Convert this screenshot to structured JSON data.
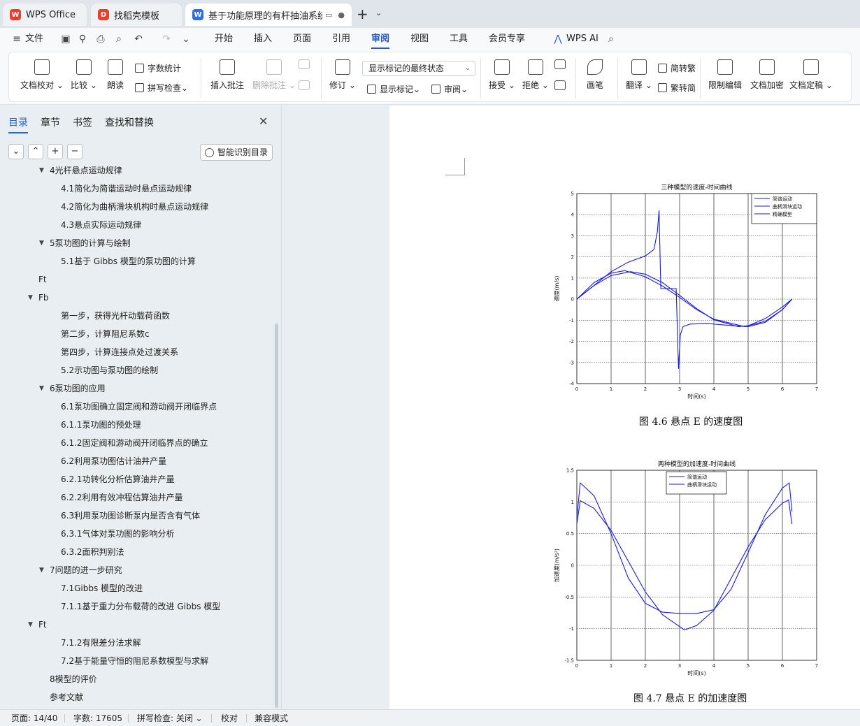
{
  "tabs": [
    {
      "label": "WPS Office",
      "icon": "wps-logo-icon",
      "color": "#e8402e"
    },
    {
      "label": "找稻壳模板",
      "icon": "docer-icon",
      "color": "#e8402e"
    },
    {
      "label": "基于功能原理的有杆抽油系统故",
      "icon": "writer-doc-icon",
      "color": "#2f6fe0"
    }
  ],
  "menu": {
    "file": "文件",
    "items": [
      "开始",
      "插入",
      "页面",
      "引用",
      "审阅",
      "视图",
      "工具",
      "会员专享"
    ],
    "active": "审阅",
    "ai": "WPS AI"
  },
  "ribbon": {
    "doc_check": "文档校对",
    "compare": "比较",
    "read_aloud": "朗读",
    "word_count": "字数统计",
    "spell_check": "拼写检查",
    "insert_comment": "插入批注",
    "delete_comment": "删除批注",
    "track_changes": "修订",
    "markup_state": "显示标记的最终状态",
    "show_markup": "显示标记",
    "review": "审阅",
    "accept": "接受",
    "reject": "拒绝",
    "pen": "画笔",
    "translate": "翻译",
    "s2t": "简转繁",
    "t2s": "繁转简",
    "restrict_edit": "限制编辑",
    "encrypt": "文档加密",
    "finalize": "文档定稿"
  },
  "sidebar": {
    "tabs": [
      "目录",
      "章节",
      "书签",
      "查找和替换"
    ],
    "active_tab": "目录",
    "smart_toc": "智能识别目录",
    "toc": [
      {
        "label": "4光杆悬点运动规律",
        "level": 1,
        "arrow": true
      },
      {
        "label": "4.1简化为简谐运动时悬点运动规律",
        "level": 2
      },
      {
        "label": "4.2简化为曲柄滑块机构时悬点运动规律",
        "level": 2
      },
      {
        "label": "4.3悬点实际运动规律",
        "level": 2
      },
      {
        "label": "5泵功图的计算与绘制",
        "level": 1,
        "arrow": true
      },
      {
        "label": "5.1基于 Gibbs 模型的泵功图的计算",
        "level": 2
      },
      {
        "label": "Ft",
        "level": 0
      },
      {
        "label": "Fb",
        "level": 0,
        "arrow": true
      },
      {
        "label": "第一步，获得光杆动载荷函数",
        "level": 2
      },
      {
        "label": "第二步，计算阻尼系数c",
        "level": 2
      },
      {
        "label": "第四步，计算连接点处过渡关系",
        "level": 2
      },
      {
        "label": "5.2示功图与泵功图的绘制",
        "level": 2
      },
      {
        "label": "6泵功图的应用",
        "level": 1,
        "arrow": true
      },
      {
        "label": "6.1泵功图确立固定阀和游动阀开闭临界点",
        "level": 2
      },
      {
        "label": "6.1.1泵功图的预处理",
        "level": 2
      },
      {
        "label": "6.1.2固定阀和游动阀开闭临界点的确立",
        "level": 2
      },
      {
        "label": "6.2利用泵功图估计油井产量",
        "level": 2
      },
      {
        "label": "6.2.1功转化分析估算油井产量",
        "level": 2
      },
      {
        "label": "6.2.2利用有效冲程估算油井产量",
        "level": 2
      },
      {
        "label": "6.3利用泵功图诊断泵内是否含有气体",
        "level": 2
      },
      {
        "label": "6.3.1气体对泵功图的影响分析",
        "level": 2
      },
      {
        "label": "6.3.2面积判别法",
        "level": 2
      },
      {
        "label": "7问题的进一步研究",
        "level": 1,
        "arrow": true
      },
      {
        "label": "7.1Gibbs 模型的改进",
        "level": 2
      },
      {
        "label": "7.1.1基于重力分布载荷的改进 Gibbs 模型",
        "level": 2
      },
      {
        "label": "Ft",
        "level": 0,
        "arrow": true
      },
      {
        "label": "7.1.2有限差分法求解",
        "level": 2
      },
      {
        "label": "7.2基于能量守恒的阻尼系数模型与求解",
        "level": 2
      },
      {
        "label": "8模型的评价",
        "level": 1
      },
      {
        "label": "参考文献",
        "level": 1
      }
    ]
  },
  "document": {
    "caption1": "图 4.6 悬点 E 的速度图",
    "caption2": "图 4.7 悬点 E 的加速度图"
  },
  "chart_data": [
    {
      "type": "line",
      "title": "三种模型的速度-时间曲线",
      "xlabel": "时间(s)",
      "ylabel": "速度(m/s)",
      "xlim": [
        0,
        7
      ],
      "ylim": [
        -4,
        5
      ],
      "xticks": [
        0,
        1,
        2,
        3,
        4,
        5,
        6,
        7
      ],
      "yticks": [
        -4,
        -3,
        -2,
        -1,
        0,
        1,
        2,
        3,
        4,
        5
      ],
      "grid": true,
      "legend": "top-right",
      "series": [
        {
          "name": "简谐运动",
          "x": [
            0,
            0.5,
            1,
            1.57,
            2,
            2.5,
            3,
            3.5,
            4,
            4.71,
            5,
            5.5,
            6,
            6.28
          ],
          "y": [
            0,
            0.64,
            1.12,
            1.3,
            1.18,
            0.78,
            0.18,
            -0.45,
            -0.98,
            -1.3,
            -1.26,
            -0.92,
            -0.37,
            0
          ]
        },
        {
          "name": "曲柄滑块运动",
          "x": [
            0,
            0.5,
            1,
            1.4,
            2,
            2.5,
            3,
            3.5,
            4,
            4.9,
            5.5,
            6,
            6.28
          ],
          "y": [
            0,
            0.78,
            1.23,
            1.35,
            1.06,
            0.62,
            0.08,
            -0.5,
            -0.95,
            -1.3,
            -1.05,
            -0.5,
            0
          ]
        },
        {
          "name": "精确模型",
          "x": [
            0,
            0.5,
            1,
            1.5,
            2,
            2.25,
            2.35,
            2.4,
            2.45,
            2.9,
            2.95,
            2.97,
            2.98,
            3.02,
            3.1,
            3.3,
            3.8,
            4.5,
            5,
            5.5,
            6,
            6.28
          ],
          "y": [
            0,
            0.65,
            1.3,
            1.75,
            2.05,
            2.35,
            3.2,
            4.2,
            0.5,
            0.5,
            -2.4,
            -3.3,
            -2.9,
            -1.7,
            -1.3,
            -1.18,
            -1.15,
            -1.25,
            -1.3,
            -1.1,
            -0.5,
            0
          ]
        }
      ]
    },
    {
      "type": "line",
      "title": "两种模型的加速度-时间曲线",
      "xlabel": "时间(s)",
      "ylabel": "加速度(m/s²)",
      "xlim": [
        0,
        7
      ],
      "ylim": [
        -1.5,
        1.5
      ],
      "xticks": [
        0,
        1,
        2,
        3,
        4,
        5,
        6,
        7
      ],
      "yticks": [
        -1.5,
        -1,
        -0.5,
        0,
        0.5,
        1,
        1.5
      ],
      "grid": true,
      "legend": "top-center",
      "series": [
        {
          "name": "简谐运动",
          "x": [
            0,
            0.1,
            0.5,
            1,
            1.57,
            2,
            2.5,
            3.14,
            3.5,
            4,
            4.71,
            5,
            5.5,
            6,
            6.18,
            6.28
          ],
          "y": [
            0.65,
            1.02,
            0.9,
            0.55,
            0.0,
            -0.42,
            -0.78,
            -1.02,
            -0.95,
            -0.71,
            0.0,
            0.29,
            0.72,
            0.98,
            1.03,
            0.65
          ]
        },
        {
          "name": "曲柄滑块运动",
          "x": [
            0,
            0.1,
            0.5,
            1,
            1.5,
            2,
            2.5,
            3,
            3.5,
            4,
            4.5,
            5,
            5.5,
            6,
            6.2,
            6.28
          ],
          "y": [
            0.75,
            1.3,
            1.1,
            0.5,
            -0.2,
            -0.6,
            -0.74,
            -0.76,
            -0.76,
            -0.7,
            -0.38,
            0.2,
            0.8,
            1.22,
            1.3,
            0.85
          ]
        }
      ]
    }
  ],
  "status": {
    "page": "页面: 14/40",
    "words": "字数: 17605",
    "spell": "拼写检查: 关闭",
    "proof": "校对",
    "compat": "兼容模式"
  },
  "colors": {
    "accent": "#2255cc",
    "series": "#1a1ae0"
  }
}
